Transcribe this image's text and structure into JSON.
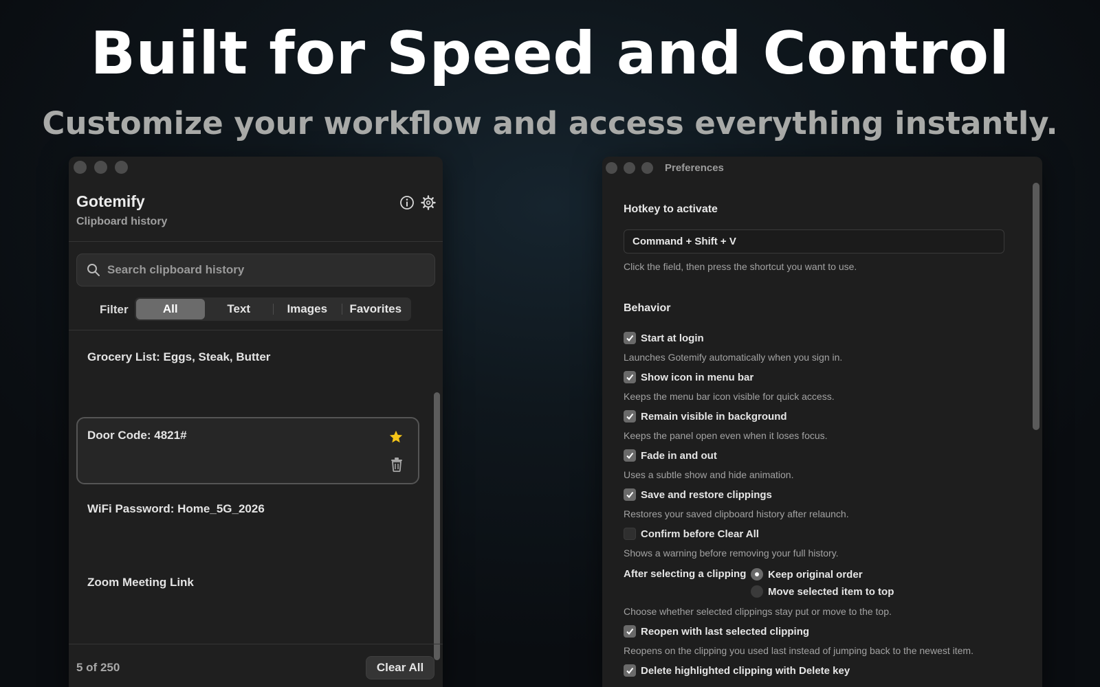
{
  "hero": {
    "title": "Built for Speed and Control",
    "subtitle": "Customize your workflow and access everything instantly."
  },
  "clipboard_window": {
    "app_name": "Gotemify",
    "subtitle": "Clipboard history",
    "search_placeholder": "Search clipboard history",
    "filter_label": "Filter",
    "filters": [
      "All",
      "Text",
      "Images",
      "Favorites"
    ],
    "active_filter": "All",
    "items": [
      {
        "text": "Grocery List: Eggs, Steak, Butter",
        "favorite": false
      },
      {
        "text": "Door Code: 4821#",
        "favorite": true,
        "selected": true
      },
      {
        "text": "WiFi Password: Home_5G_2026",
        "favorite": false
      },
      {
        "text": "Zoom Meeting Link",
        "favorite": false
      }
    ],
    "count": "5 of 250",
    "clear_all": "Clear All",
    "star_color": "#f5c518"
  },
  "preferences_window": {
    "title": "Preferences",
    "hotkey": {
      "heading": "Hotkey to activate",
      "value": "Command + Shift + V",
      "hint": "Click the field, then press the shortcut you want to use."
    },
    "behavior": {
      "heading": "Behavior",
      "options": [
        {
          "label": "Start at login",
          "checked": true,
          "hint": "Launches Gotemify automatically when you sign in."
        },
        {
          "label": "Show icon in menu bar",
          "checked": true,
          "hint": "Keeps the menu bar icon visible for quick access."
        },
        {
          "label": "Remain visible in background",
          "checked": true,
          "hint": "Keeps the panel open even when it loses focus."
        },
        {
          "label": "Fade in and out",
          "checked": true,
          "hint": "Uses a subtle show and hide animation."
        },
        {
          "label": "Save and restore clippings",
          "checked": true,
          "hint": "Restores your saved clipboard history after relaunch."
        },
        {
          "label": "Confirm before Clear All",
          "checked": false,
          "hint": "Shows a warning before removing your full history."
        }
      ],
      "after_selecting": {
        "label": "After selecting a clipping",
        "options": [
          "Keep original order",
          "Move selected item to top"
        ],
        "selected": "Keep original order",
        "hint": "Choose whether selected clippings stay put or move to the top."
      },
      "more_options": [
        {
          "label": "Reopen with last selected clipping",
          "checked": true,
          "hint": "Reopens on the clipping you used last instead of jumping back to the newest item."
        },
        {
          "label": "Delete highlighted clipping with Delete key",
          "checked": true
        }
      ]
    }
  }
}
